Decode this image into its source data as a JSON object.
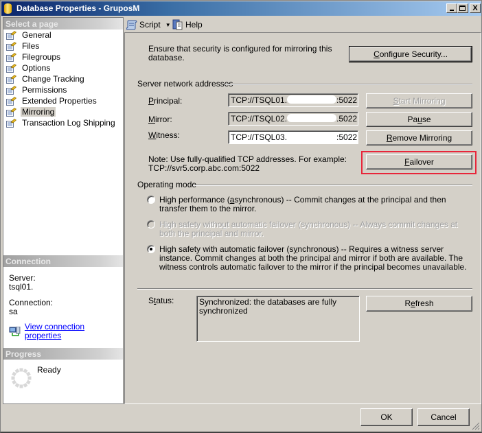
{
  "window": {
    "title": "Database Properties - GruposM",
    "controls": {
      "minimize": "_",
      "maximize": "□",
      "close": "X"
    }
  },
  "sidebar": {
    "select_page_header": "Select a page",
    "pages": [
      {
        "label": "General",
        "icon": "page-wrench-icon",
        "selected": false
      },
      {
        "label": "Files",
        "icon": "page-wrench-icon",
        "selected": false
      },
      {
        "label": "Filegroups",
        "icon": "page-wrench-icon",
        "selected": false
      },
      {
        "label": "Options",
        "icon": "page-wrench-icon",
        "selected": false
      },
      {
        "label": "Change Tracking",
        "icon": "page-wrench-icon",
        "selected": false
      },
      {
        "label": "Permissions",
        "icon": "page-wrench-icon",
        "selected": false
      },
      {
        "label": "Extended Properties",
        "icon": "page-wrench-icon",
        "selected": false
      },
      {
        "label": "Mirroring",
        "icon": "page-wrench-icon",
        "selected": true
      },
      {
        "label": "Transaction Log Shipping",
        "icon": "page-wrench-icon",
        "selected": false
      }
    ],
    "connection_header": "Connection",
    "server_label": "Server:",
    "server_value": "tsql01.",
    "connection_label": "Connection:",
    "connection_value": "sa",
    "view_connection_link": "View connection properties",
    "progress_header": "Progress",
    "progress_status": "Ready"
  },
  "toolbar": {
    "script_label": "Script",
    "help_label": "Help"
  },
  "mirroring": {
    "security_note": "Ensure that security is configured for mirroring this database.",
    "configure_security_button": "Configure Security...",
    "server_addresses_group": "Server network addresses",
    "principal_label": "Principal:",
    "principal_value_prefix": "TCP://TSQL01.",
    "principal_value_suffix": ":5022",
    "mirror_label": "Mirror:",
    "mirror_value_prefix": "TCP://TSQL02.",
    "mirror_value_suffix": ".5022",
    "witness_label": "Witness:",
    "witness_value_prefix": "TCP://TSQL03.",
    "witness_value_suffix": ":5022",
    "start_mirroring_button": "Start Mirroring",
    "pause_button": "Pause",
    "remove_mirroring_button": "Remove Mirroring",
    "failover_button": "Failover",
    "note_line1": "Note: Use fully-qualified TCP addresses. For example:",
    "note_line2": "TCP://svr5.corp.abc.com:5022",
    "operating_mode_group": "Operating mode",
    "modes": [
      {
        "label": "High performance (asynchronous) -- Commit changes at the principal and then transfer them to the mirror.",
        "selected": false,
        "enabled": true
      },
      {
        "label": "High safety without automatic failover (synchronous) -- Always commit changes at both the principal and mirror.",
        "selected": false,
        "enabled": false
      },
      {
        "label": "High safety with automatic failover (synchronous) -- Requires a witness server instance. Commit changes at both the principal and mirror if both are available. The witness controls automatic failover to the mirror if the principal becomes unavailable.",
        "selected": true,
        "enabled": true
      }
    ],
    "status_label": "Status:",
    "status_value": "Synchronized: the databases are fully synchronized",
    "refresh_button": "Refresh"
  },
  "footer": {
    "ok_button": "OK",
    "cancel_button": "Cancel"
  },
  "colors": {
    "highlight_box": "#e8263a",
    "link": "#0000ff",
    "dialog_bg": "#d4d0c8"
  }
}
